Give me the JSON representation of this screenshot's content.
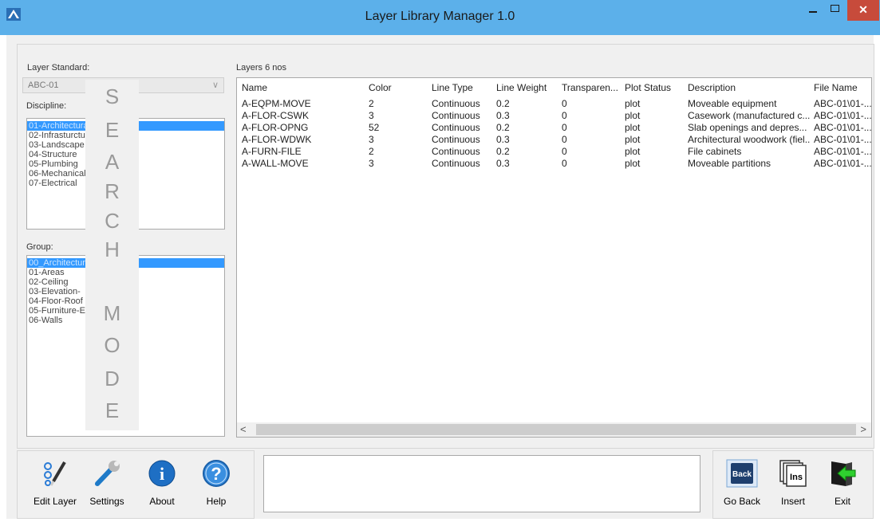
{
  "window": {
    "title": "Layer Library Manager 1.0",
    "close_glyph": "✕"
  },
  "left": {
    "layer_standard_label": "Layer Standard:",
    "layer_standard_value": "ABC-01",
    "combo_arrow": "∨",
    "discipline_label": "Discipline:",
    "disciplines": [
      "01-Architectural",
      "02-Infrasturcture",
      "03-Landscape",
      "04-Structure",
      "05-Plumbing",
      "06-Mechanical",
      "07-Electrical"
    ],
    "group_label": "Group:",
    "groups": [
      "00_Architectural",
      "01-Areas",
      "02-Ceiling",
      "03-Elevation-",
      "04-Floor-Roof",
      "05-Furniture-Equipment",
      "06-Walls"
    ],
    "search_overlay": [
      "S",
      "E",
      "A",
      "R",
      "C",
      "H",
      "M",
      "O",
      "D",
      "E"
    ]
  },
  "layers": {
    "heading": "Layers 6 nos",
    "columns": [
      "Name",
      "Color",
      "Line Type",
      "Line Weight",
      "Transparen...",
      "Plot Status",
      "Description",
      "File Name"
    ],
    "rows": [
      [
        "A-EQPM-MOVE",
        "2",
        "Continuous",
        "0.2",
        "0",
        "plot",
        "Moveable equipment",
        "ABC-01\\01-..."
      ],
      [
        "A-FLOR-CSWK",
        "3",
        "Continuous",
        "0.3",
        "0",
        "plot",
        "Casework (manufactured c...",
        "ABC-01\\01-..."
      ],
      [
        "A-FLOR-OPNG",
        "52",
        "Continuous",
        "0.2",
        "0",
        "plot",
        "Slab openings and depres...",
        "ABC-01\\01-..."
      ],
      [
        "A-FLOR-WDWK",
        "3",
        "Continuous",
        "0.3",
        "0",
        "plot",
        "Architectural woodwork (fiel...",
        "ABC-01\\01-..."
      ],
      [
        "A-FURN-FILE",
        "2",
        "Continuous",
        "0.2",
        "0",
        "plot",
        "File cabinets",
        "ABC-01\\01-..."
      ],
      [
        "A-WALL-MOVE",
        "3",
        "Continuous",
        "0.3",
        "0",
        "plot",
        "Moveable partitions",
        "ABC-01\\01-..."
      ]
    ],
    "scroll_left": "<",
    "scroll_right": ">"
  },
  "toolbar": {
    "edit_layer": "Edit Layer",
    "settings": "Settings",
    "about": "About",
    "help": "Help",
    "about_glyph": "i",
    "help_glyph": "?",
    "go_back": "Go Back",
    "insert": "Insert",
    "exit": "Exit",
    "back_icon_text": "Back",
    "ins_icon_text": "Ins"
  },
  "colors": {
    "titlebar": "#5cb0ea",
    "selection": "#3399ff",
    "close": "#c74b3b"
  },
  "icons": [
    "app-logo-icon",
    "edit-layer-icon",
    "wrench-icon",
    "info-icon",
    "help-icon",
    "back-icon",
    "insert-icon",
    "exit-icon"
  ]
}
